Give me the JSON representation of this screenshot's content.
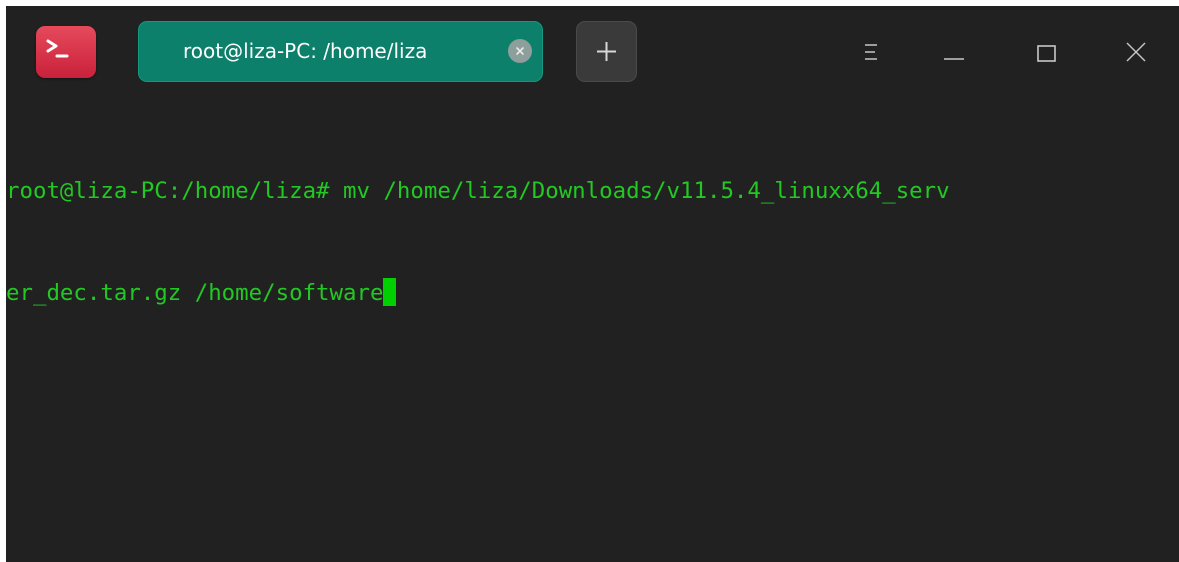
{
  "window": {
    "tab_title": "root@liza-PC: /home/liza",
    "colors": {
      "background": "#212121",
      "tab_active": "#0d806c",
      "terminal_text": "#22c922",
      "cursor": "#00d000",
      "app_icon": "#d9304a"
    },
    "icons": {
      "app": "terminal-icon",
      "tab_close": "close-circle-icon",
      "new_tab": "plus-icon",
      "menu": "hamburger-menu-icon",
      "minimize": "minimize-icon",
      "maximize": "maximize-icon",
      "close": "close-icon"
    }
  },
  "terminal": {
    "lines": [
      "root@liza-PC:/home/liza# mv /home/liza/Downloads/v11.5.4_linuxx64_serv",
      "er_dec.tar.gz /home/software"
    ]
  }
}
